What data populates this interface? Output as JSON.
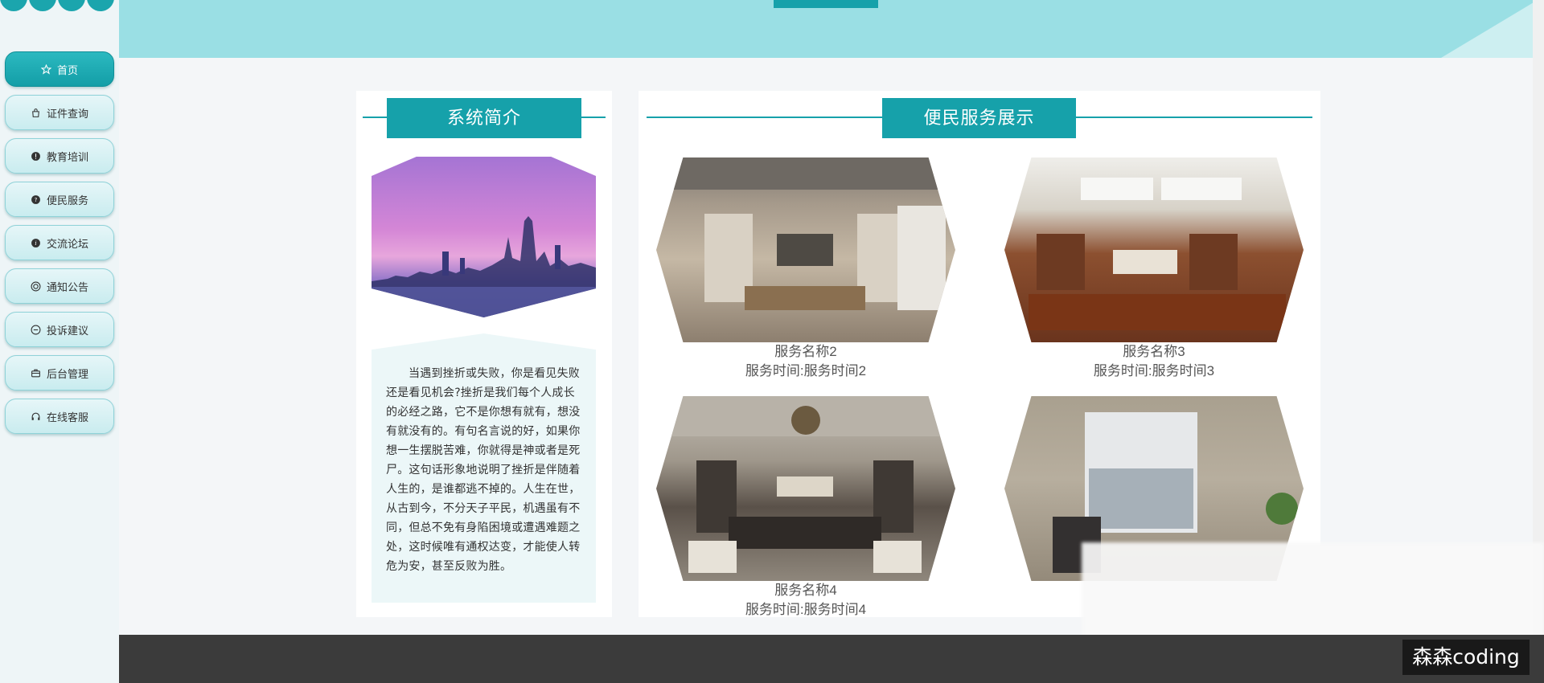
{
  "sidebar": {
    "items": [
      {
        "label": "首页",
        "icon": "star-icon",
        "active": true
      },
      {
        "label": "证件查询",
        "icon": "bag-icon"
      },
      {
        "label": "教育培训",
        "icon": "alert-circle-icon"
      },
      {
        "label": "便民服务",
        "icon": "help-circle-icon"
      },
      {
        "label": "交流论坛",
        "icon": "info-circle-icon"
      },
      {
        "label": "通知公告",
        "icon": "target-icon"
      },
      {
        "label": "投诉建议",
        "icon": "minus-circle-icon"
      },
      {
        "label": "后台管理",
        "icon": "briefcase-icon"
      },
      {
        "label": "在线客服",
        "icon": "headset-icon"
      }
    ]
  },
  "intro": {
    "title": "系统简介",
    "text": "当遇到挫折或失败，你是看见失败还是看见机会?挫折是我们每个人成长的必经之路，它不是你想有就有，想没有就没有的。有句名言说的好，如果你想一生摆脱苦难，你就得是神或者是死尸。这句话形象地说明了挫折是伴随着人生的，是谁都逃不掉的。人生在世，从古到今，不分天子平民，机遇虽有不同，但总不免有身陷困境或遭遇难题之处，这时候唯有通权达变，才能使人转危为安，甚至反败为胜。"
  },
  "services": {
    "title": "便民服务展示",
    "items": [
      {
        "name": "服务名称2",
        "time": "服务时间:服务时间2"
      },
      {
        "name": "服务名称3",
        "time": "服务时间:服务时间3"
      },
      {
        "name": "服务名称4",
        "time": "服务时间:服务时间4"
      },
      {
        "name": "",
        "time": ""
      }
    ]
  },
  "watermark": "森森coding",
  "colors": {
    "accent": "#16a1aa",
    "header_band": "#9adfe4",
    "footer": "#3b3b3b"
  }
}
